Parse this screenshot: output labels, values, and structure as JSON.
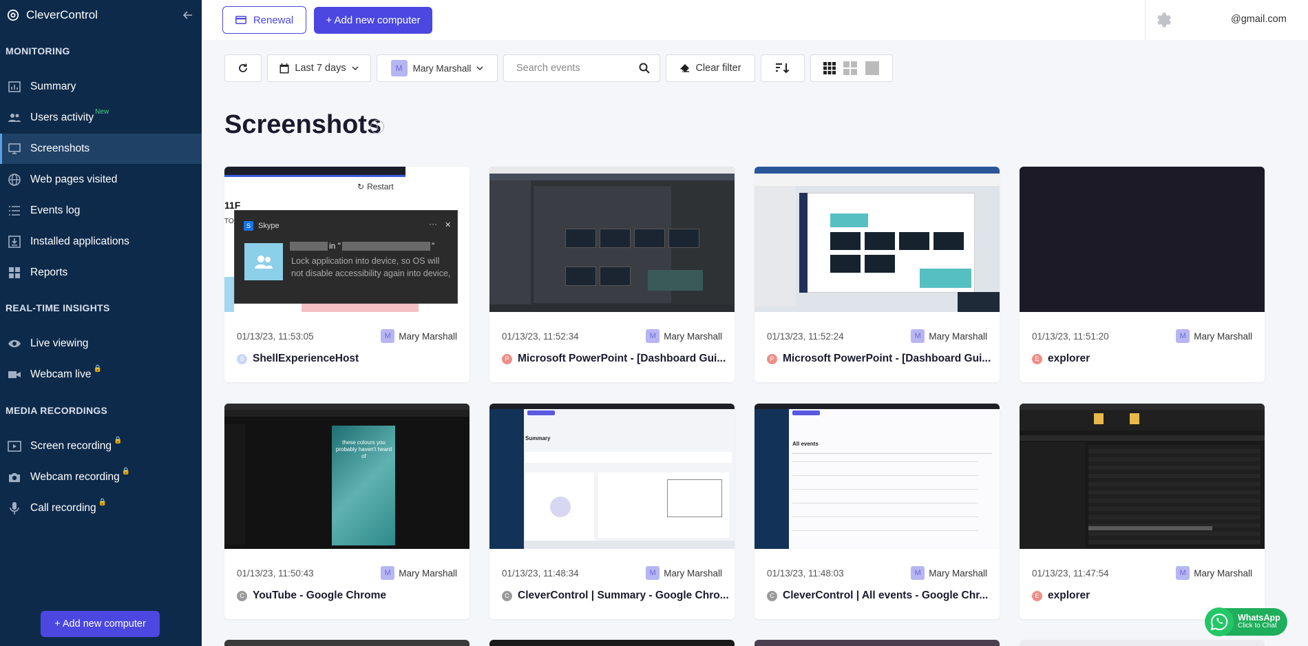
{
  "sidebar": {
    "brand": "CleverControl",
    "sections": {
      "monitoring": "MONITORING",
      "realtime": "REAL-TIME INSIGHTS",
      "media": "MEDIA RECORDINGS"
    },
    "items": {
      "summary": "Summary",
      "users_activity": "Users activity",
      "users_activity_badge": "New",
      "screenshots": "Screenshots",
      "web_pages": "Web pages visited",
      "events_log": "Events log",
      "installed_apps": "Installed applications",
      "reports": "Reports",
      "live_viewing": "Live viewing",
      "webcam_live": "Webcam live",
      "screen_recording": "Screen recording",
      "webcam_recording": "Webcam recording",
      "call_recording": "Call recording"
    },
    "add_computer": "+ Add new computer"
  },
  "topbar": {
    "renewal": "Renewal",
    "add_computer": "+ Add new computer",
    "email": "@gmail.com"
  },
  "filters": {
    "date_range": "Last 7 days",
    "user_initial": "M",
    "user_name": "Mary Marshall",
    "search_placeholder": "Search events",
    "clear_filter": "Clear filter"
  },
  "page": {
    "title": "Screenshots",
    "info_glyph": "i"
  },
  "screenshots": [
    {
      "time": "01/13/23, 11:53:05",
      "user": "Mary Marshall",
      "user_initial": "M",
      "app": "ShellExperienceHost",
      "app_initial": "S",
      "app_color": "#c9d6f5"
    },
    {
      "time": "01/13/23, 11:52:34",
      "user": "Mary Marshall",
      "user_initial": "M",
      "app": "Microsoft PowerPoint - [Dashboard Gui...",
      "app_initial": "P",
      "app_color": "#f08d86"
    },
    {
      "time": "01/13/23, 11:52:24",
      "user": "Mary Marshall",
      "user_initial": "M",
      "app": "Microsoft PowerPoint - [Dashboard Gui...",
      "app_initial": "P",
      "app_color": "#f08d86"
    },
    {
      "time": "01/13/23, 11:51:20",
      "user": "Mary Marshall",
      "user_initial": "M",
      "app": "explorer",
      "app_initial": "E",
      "app_color": "#f08d86"
    },
    {
      "time": "01/13/23, 11:50:43",
      "user": "Mary Marshall",
      "user_initial": "M",
      "app": "YouTube - Google Chrome",
      "app_initial": "C",
      "app_color": "#9a9a9a"
    },
    {
      "time": "01/13/23, 11:48:34",
      "user": "Mary Marshall",
      "user_initial": "M",
      "app": "CleverControl | Summary - Google Chro...",
      "app_initial": "C",
      "app_color": "#9a9a9a"
    },
    {
      "time": "01/13/23, 11:48:03",
      "user": "Mary Marshall",
      "user_initial": "M",
      "app": "CleverControl | All events - Google Chr...",
      "app_initial": "C",
      "app_color": "#9a9a9a"
    },
    {
      "time": "01/13/23, 11:47:54",
      "user": "Mary Marshall",
      "user_initial": "M",
      "app": "explorer",
      "app_initial": "E",
      "app_color": "#f08d86"
    }
  ],
  "thumb1": {
    "restart": "Restart",
    "code": "11F",
    "code2": "TO",
    "toast_app": "Skype",
    "toast_app_initial": "S",
    "toast_in": "in \"",
    "toast_quote": "\"",
    "toast_body": "Lock application into device, so OS will not disable accessibility again into device,",
    "toast_more": "···",
    "toast_close": "✕"
  },
  "thumb5": {
    "caption": "these colours you probably haven't heard of"
  },
  "thumb6": {
    "heading": "Summary"
  },
  "thumb7": {
    "heading": "All events"
  },
  "whatsapp": {
    "title": "WhatsApp",
    "subtitle": "Click to Chat"
  },
  "colors": {
    "sidebar": "#0e2a4a",
    "accent": "#4b47e0",
    "lock": "#34c36b"
  }
}
